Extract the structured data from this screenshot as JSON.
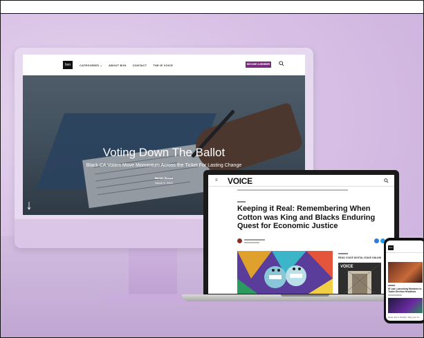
{
  "desktop": {
    "nav": {
      "logo": "bvn",
      "links": [
        "CATEGORIES ⌄",
        "ABOUT BVN",
        "CONTACT",
        "THE IE VOICE"
      ],
      "member_button": "BECOME A MEMBER"
    },
    "hero": {
      "title": "Voting Down The Ballot",
      "subtitle": "Black CA Voters Move Momentum Across the Ticket For Lasting Change",
      "author": "Mariah Brown",
      "date": "March 5, 2022",
      "scroll_icon": "arrow-down-icon"
    }
  },
  "laptop": {
    "logo": "VOICE",
    "headline": "Keeping it Real: Remembering When Cotton was King and Blacks Enduring Quest for Economic Justice",
    "sidebar_title": "READ VOICE DIGITAL ISSUE ONLINE",
    "sidebar_logo": "VOICE"
  },
  "phone": {
    "logo": "bvn",
    "headline": "IE Law: Launching Members to Tackle Election Headlines",
    "footer": "Never Just a Tick Box: Why Love Yo..."
  },
  "colors": {
    "background": "#d9c2e6",
    "member_button": "#7a2b7d",
    "device_frame": "#e7d9ef"
  }
}
